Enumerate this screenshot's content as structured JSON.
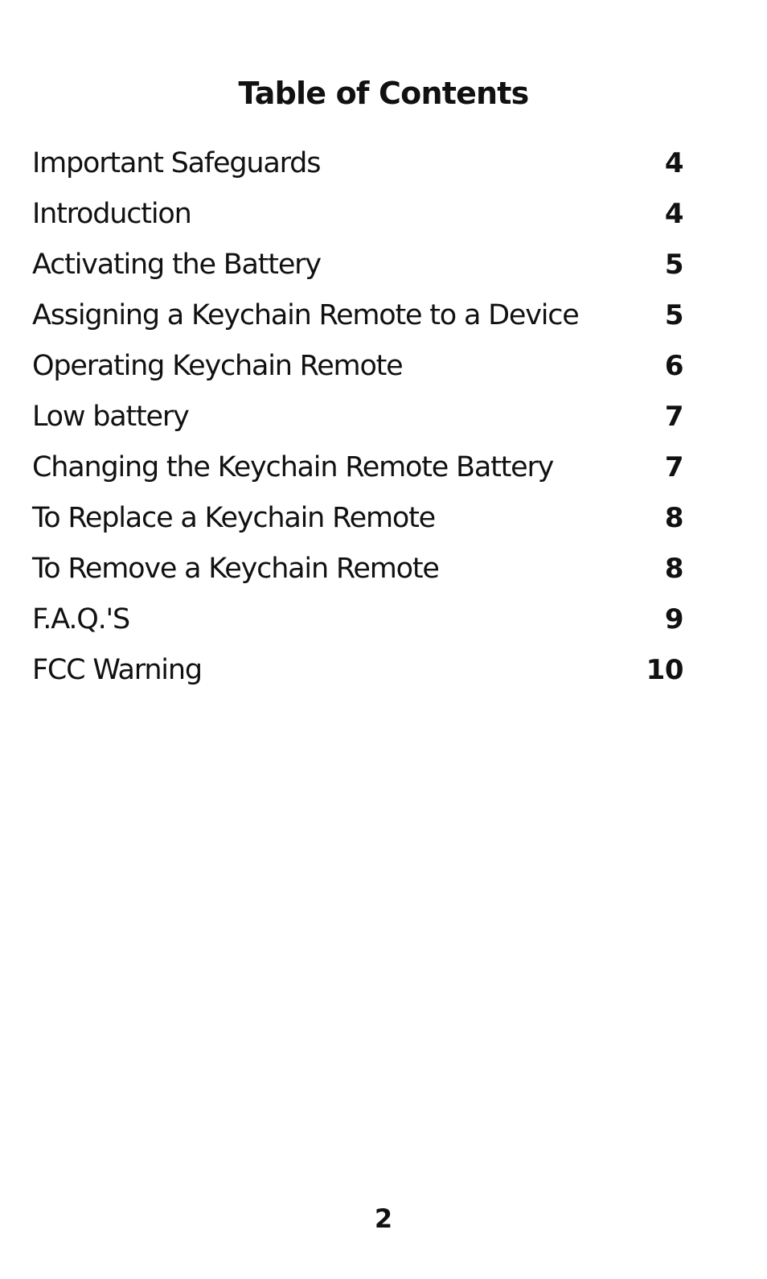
{
  "document": {
    "title": "Table of Contents",
    "page_number": "2"
  },
  "toc": {
    "entries": [
      {
        "label": "Important Safeguards",
        "page": "4"
      },
      {
        "label": "Introduction",
        "page": "4"
      },
      {
        "label": "Activating the Battery",
        "page": "5"
      },
      {
        "label": "Assigning a Keychain Remote to a Device",
        "page": "5"
      },
      {
        "label": "Operating Keychain Remote",
        "page": "6"
      },
      {
        "label": "Low battery",
        "page": "7"
      },
      {
        "label": "Changing the Keychain Remote Battery",
        "page": "7"
      },
      {
        "label": "To Replace a Keychain Remote",
        "page": "8"
      },
      {
        "label": "To Remove a Keychain Remote",
        "page": "8"
      },
      {
        "label": "F.A.Q.'S",
        "page": "9"
      },
      {
        "label": "FCC Warning",
        "page": "10"
      }
    ]
  }
}
